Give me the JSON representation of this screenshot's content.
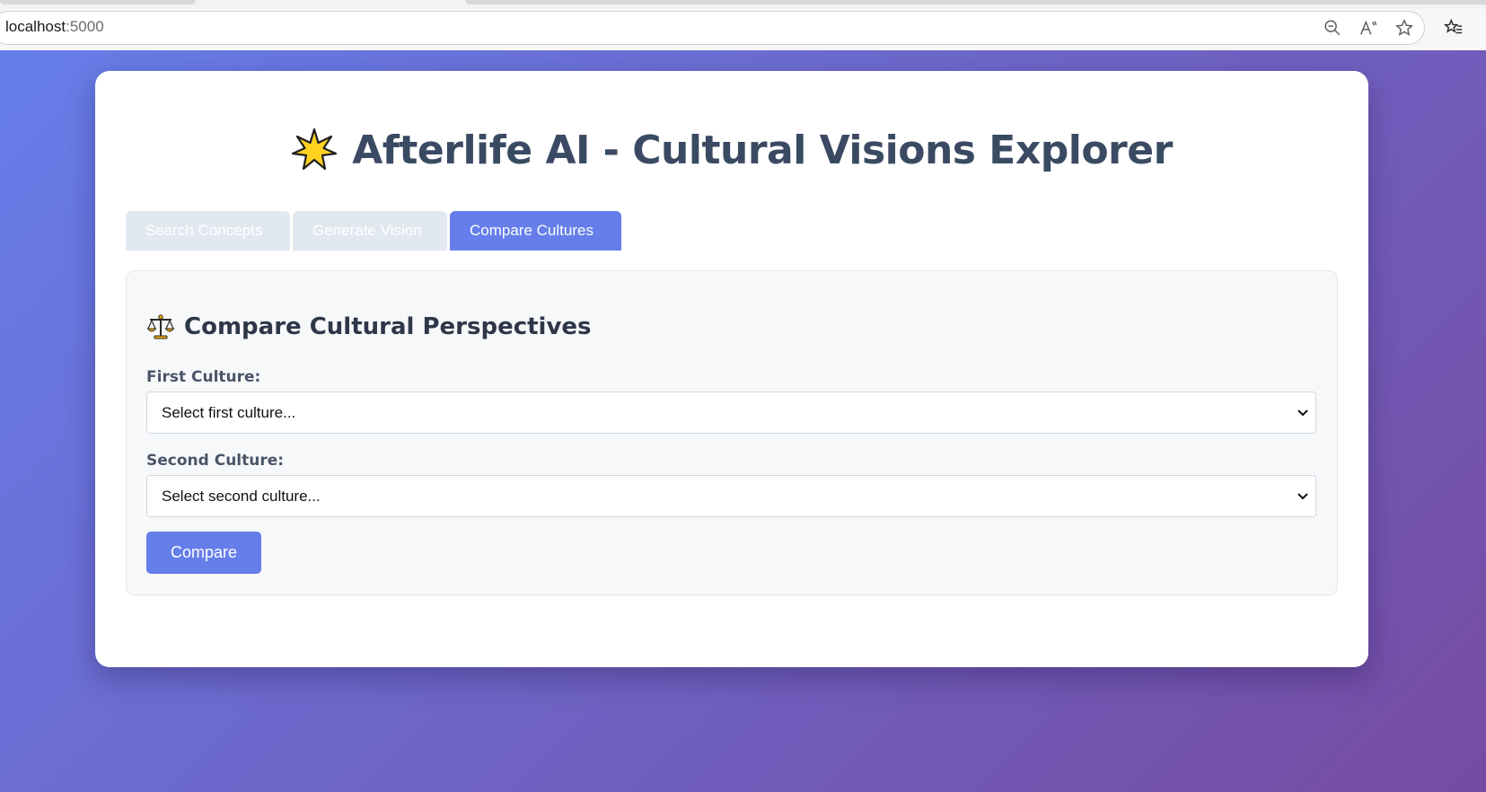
{
  "browser": {
    "address_host": "localhost",
    "address_port": ":5000",
    "icons": [
      "zoom-out-icon",
      "read-aloud-icon",
      "favorite-star-icon",
      "favorites-list-icon"
    ]
  },
  "page": {
    "title": "Afterlife AI - Cultural Visions Explorer",
    "title_icon": "glowing-star-icon",
    "tabs": [
      {
        "label": "Search Concepts",
        "active": false
      },
      {
        "label": "Generate Vision",
        "active": false
      },
      {
        "label": "Compare Cultures",
        "active": true
      }
    ],
    "compare": {
      "heading": "Compare Cultural Perspectives",
      "heading_icon": "balance-scale-icon",
      "first_label": "First Culture:",
      "first_value": "Select first culture...",
      "second_label": "Second Culture:",
      "second_value": "Select second culture...",
      "button_label": "Compare"
    }
  },
  "colors": {
    "gradient_start": "#667eea",
    "gradient_end": "#764ba2",
    "accent": "#667eea",
    "inactive_tab": "#e2e8f0",
    "title_text": "#3a4a63"
  }
}
